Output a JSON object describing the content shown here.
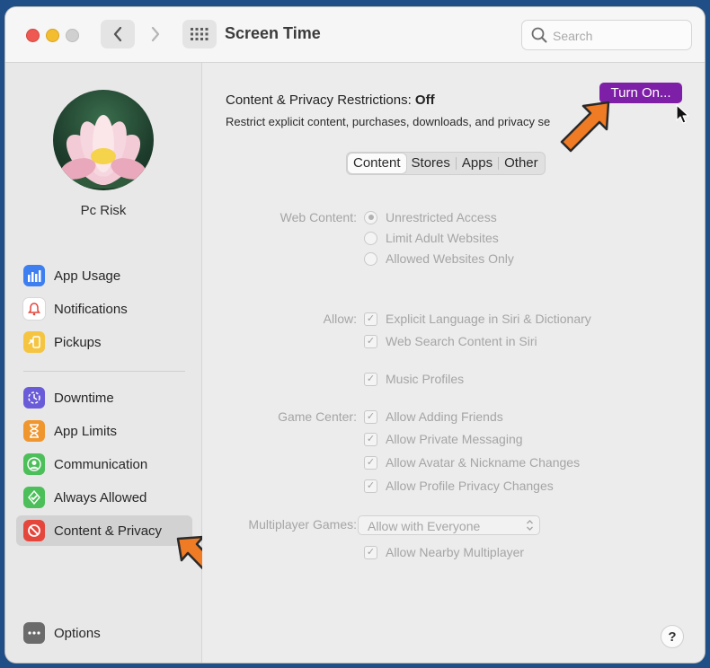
{
  "window": {
    "title": "Screen Time"
  },
  "search": {
    "placeholder": "Search"
  },
  "user": {
    "name": "Pc Risk"
  },
  "sidebar": {
    "items": [
      {
        "label": "App Usage",
        "icon": "bar-chart-icon",
        "color": "#3d7ff0"
      },
      {
        "label": "Notifications",
        "icon": "bell-icon",
        "color": "#ffffff"
      },
      {
        "label": "Pickups",
        "icon": "phone-arrow-icon",
        "color": "#f5c542"
      },
      {
        "label": "Downtime",
        "icon": "moon-clock-icon",
        "color": "#6a5bd8"
      },
      {
        "label": "App Limits",
        "icon": "hourglass-icon",
        "color": "#f0962f"
      },
      {
        "label": "Communication",
        "icon": "person-icon",
        "color": "#4cbf5a"
      },
      {
        "label": "Always Allowed",
        "icon": "checkmark-shield-icon",
        "color": "#4cbf5a"
      },
      {
        "label": "Content & Privacy",
        "icon": "no-entry-icon",
        "color": "#e5463c"
      },
      {
        "label": "Options",
        "icon": "ellipsis-icon",
        "color": "#6b6b6b"
      }
    ],
    "selected": "Content & Privacy"
  },
  "main": {
    "heading_label": "Content & Privacy Restrictions:",
    "heading_state": "Off",
    "description": "Restrict explicit content, purchases, downloads, and privacy se",
    "turn_on_label": "Turn On...",
    "turn_on_color": "#7e1fa8",
    "tabs": [
      {
        "label": "Content",
        "active": true
      },
      {
        "label": "Stores",
        "active": false
      },
      {
        "label": "Apps",
        "active": false
      },
      {
        "label": "Other",
        "active": false
      }
    ],
    "web_content": {
      "label": "Web Content:",
      "options": [
        "Unrestricted Access",
        "Limit Adult Websites",
        "Allowed Websites Only"
      ],
      "selected": "Unrestricted Access"
    },
    "allow": {
      "label": "Allow:",
      "items": [
        "Explicit Language in Siri & Dictionary",
        "Web Search Content in Siri",
        "Music Profiles"
      ]
    },
    "game_center": {
      "label": "Game Center:",
      "items": [
        "Allow Adding Friends",
        "Allow Private Messaging",
        "Allow Avatar & Nickname Changes",
        "Allow Profile Privacy Changes"
      ]
    },
    "multiplayer": {
      "label": "Multiplayer Games:",
      "value": "Allow with Everyone",
      "nearby_label": "Allow Nearby Multiplayer"
    },
    "help_label": "?"
  }
}
